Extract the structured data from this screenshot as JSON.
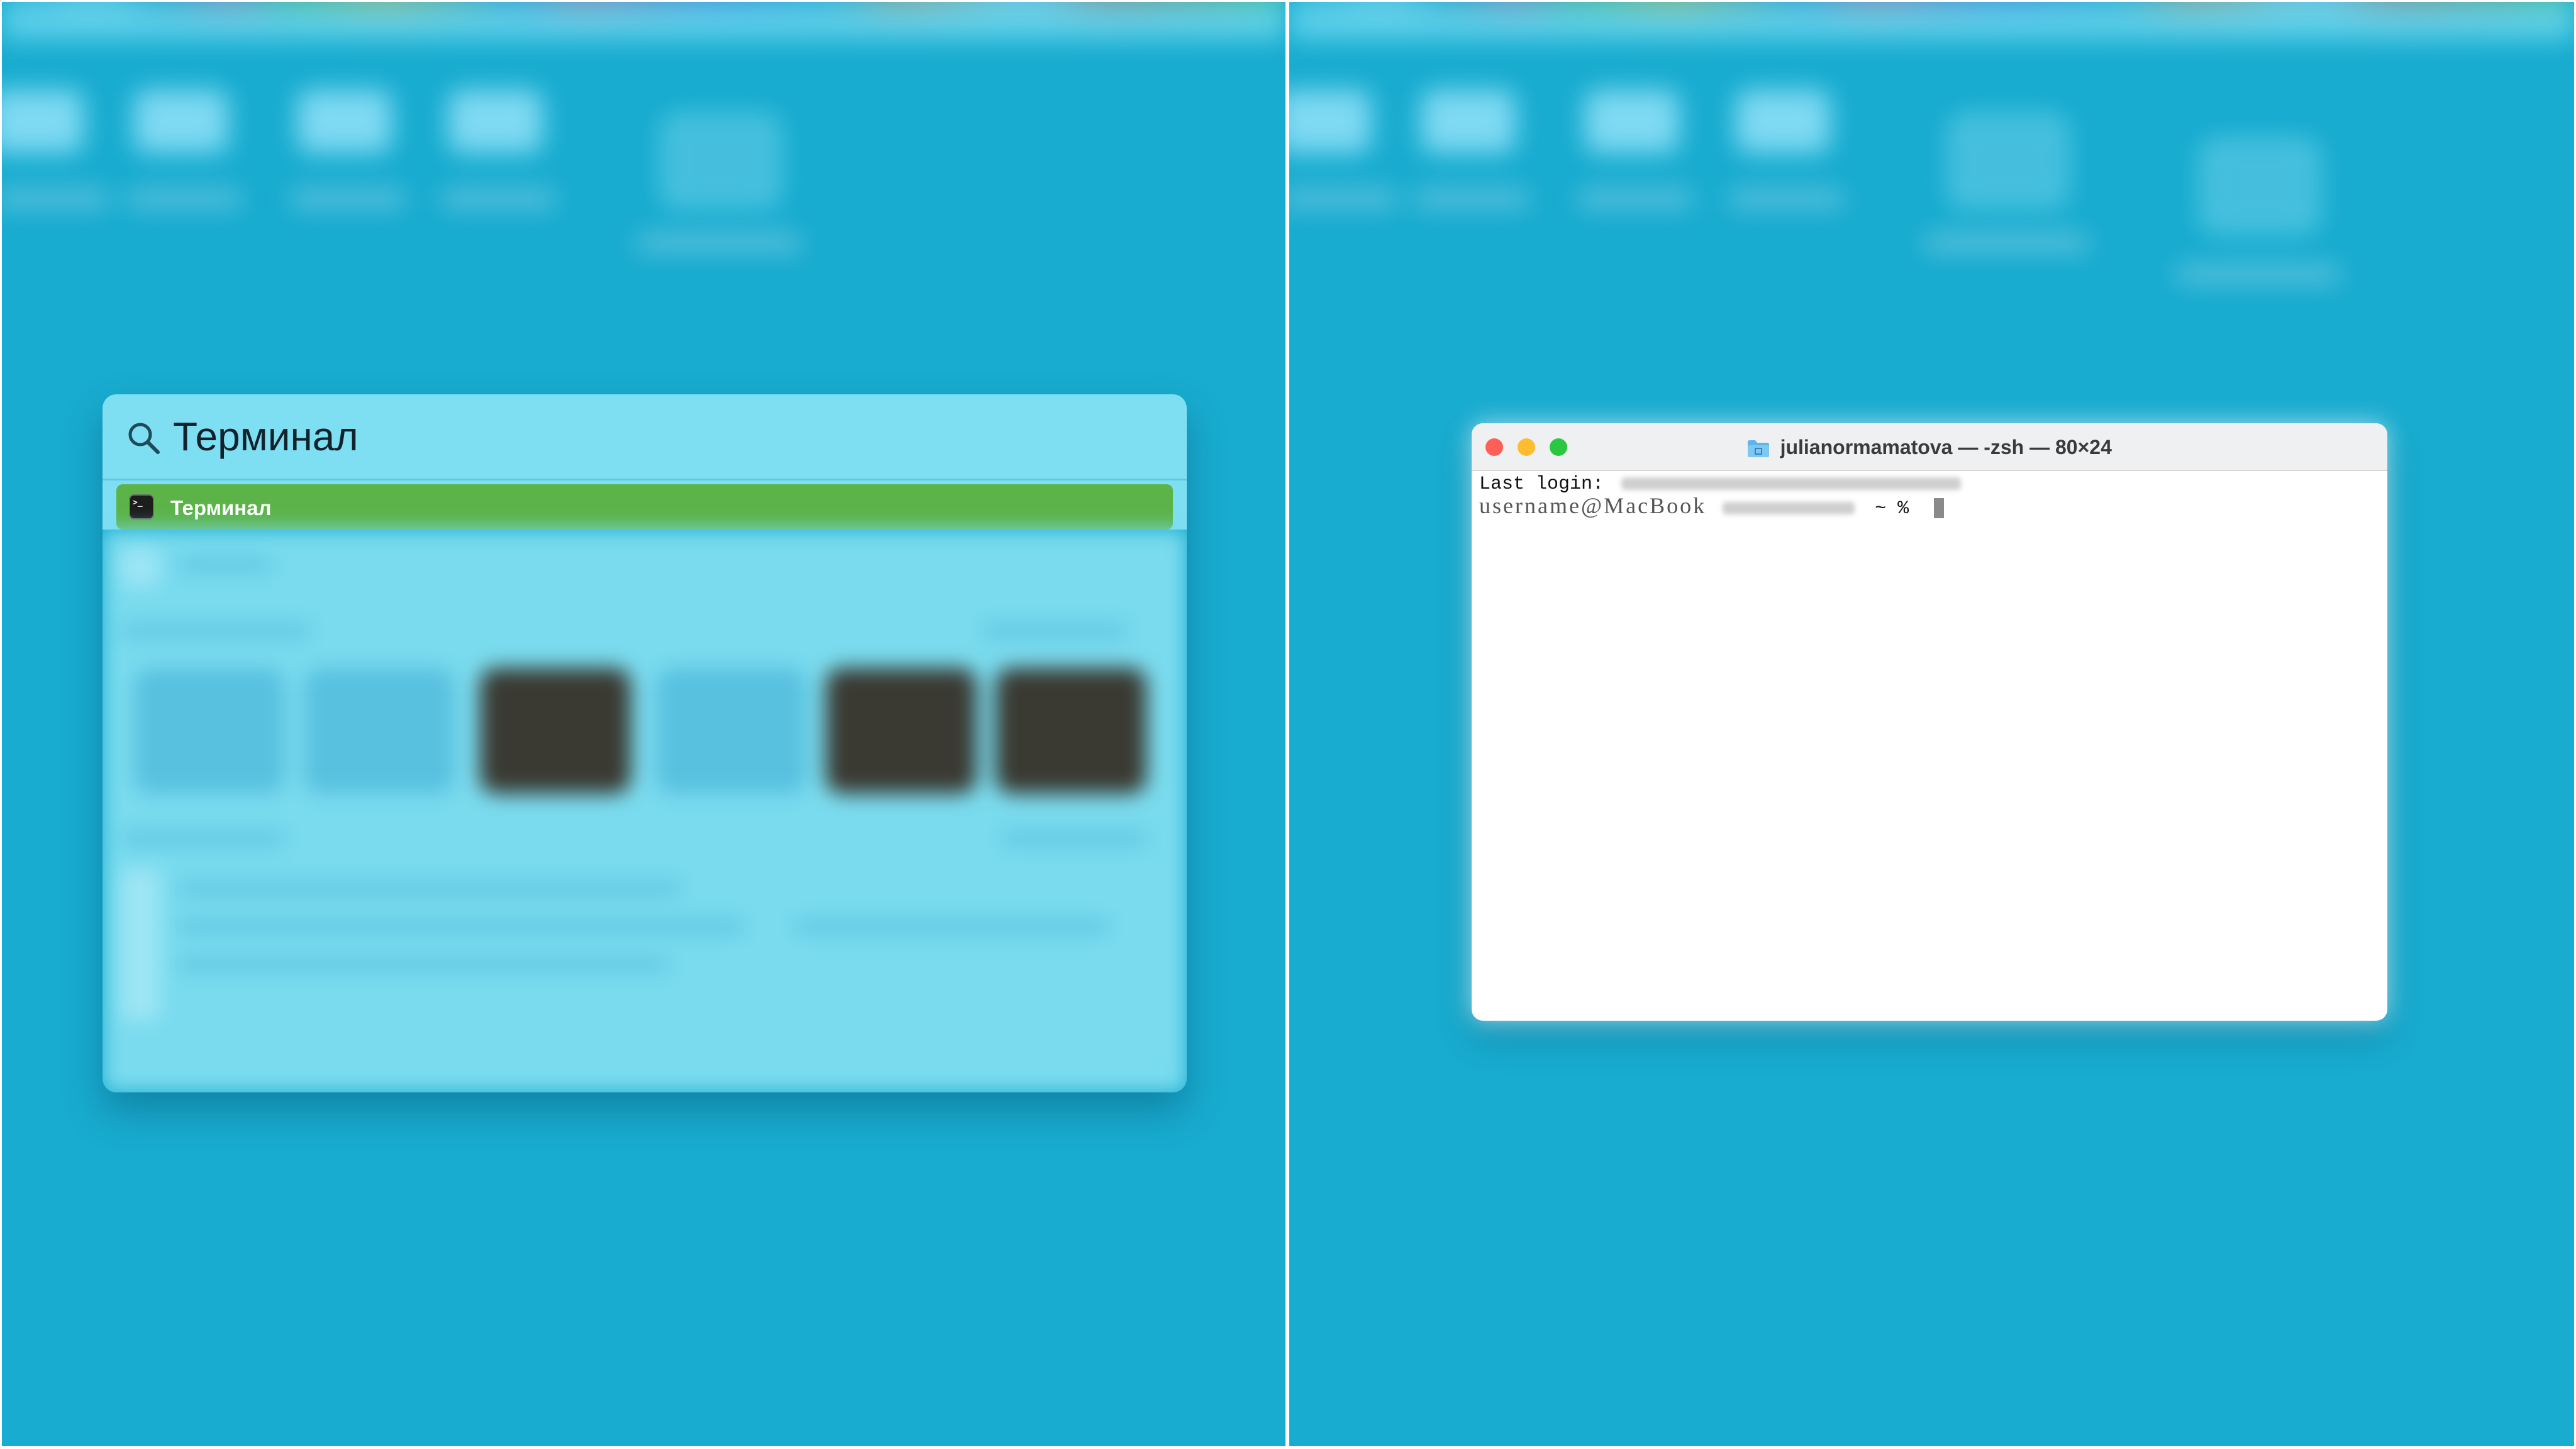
{
  "spotlight": {
    "search_query": "Терминал",
    "selected_result": {
      "label": "Терминал",
      "icon": "terminal-app-icon"
    },
    "highlight_color": "#5cb348"
  },
  "terminal_window": {
    "title": "julianormamatova — -zsh — 80×24",
    "last_login_label": "Last login:",
    "prompt_user": "username@MacBook",
    "prompt_suffix": "~ %",
    "traffic_lights": {
      "close_color": "#ff5f57",
      "minimize_color": "#febc2e",
      "zoom_color": "#28c840"
    }
  },
  "desktop": {
    "background_color": "#18acd0"
  }
}
